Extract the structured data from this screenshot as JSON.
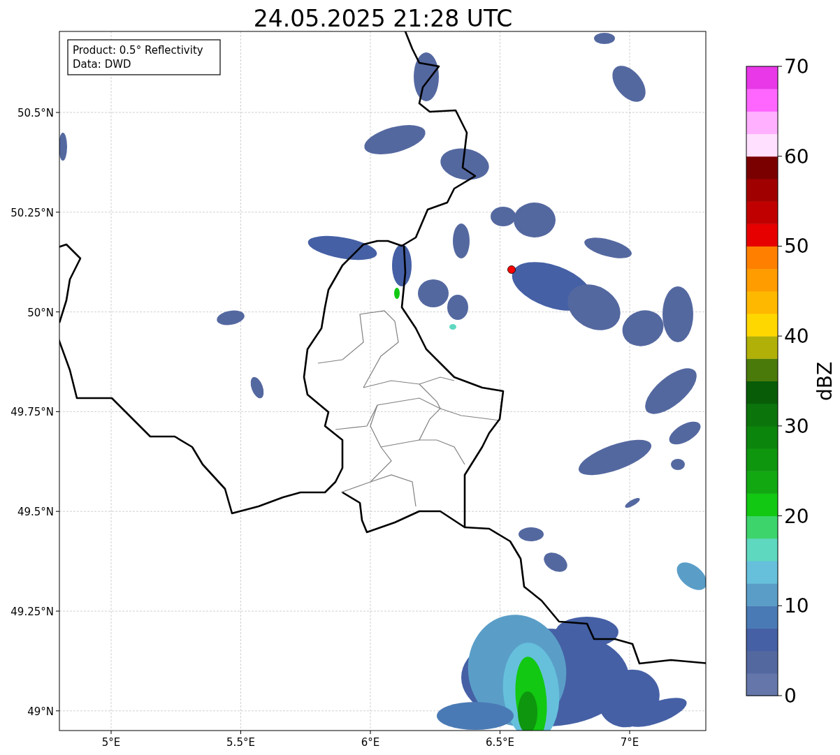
{
  "title": "24.05.2025 21:28 UTC",
  "info_box": [
    "Product: 0.5° Reflectivity",
    "Data: DWD"
  ],
  "map": {
    "lat_ticks": [
      "50.5°N",
      "50.25°N",
      "50°N",
      "49.75°N",
      "49.5°N",
      "49.25°N",
      "49°N"
    ],
    "lon_ticks": [
      "5°E",
      "5.5°E",
      "6°E",
      "6.5°E",
      "7°E"
    ]
  },
  "colorbar": {
    "label": "dBZ",
    "ticks": [
      "70",
      "60",
      "50",
      "40",
      "30",
      "20",
      "10",
      "0"
    ],
    "bins": [
      {
        "color": "#6577aa"
      },
      {
        "color": "#5468a0"
      },
      {
        "color": "#4560a5"
      },
      {
        "color": "#4a7ab5"
      },
      {
        "color": "#5a9ec8"
      },
      {
        "color": "#66c0dc"
      },
      {
        "color": "#5fd8c0"
      },
      {
        "color": "#3dd46c"
      },
      {
        "color": "#12c812"
      },
      {
        "color": "#12a812"
      },
      {
        "color": "#0e960e"
      },
      {
        "color": "#0c850c"
      },
      {
        "color": "#0b740b"
      },
      {
        "color": "#085c08"
      },
      {
        "color": "#4a7a0a"
      },
      {
        "color": "#b0b008"
      },
      {
        "color": "#ffd700"
      },
      {
        "color": "#ffb800"
      },
      {
        "color": "#ff9c00"
      },
      {
        "color": "#ff8000"
      },
      {
        "color": "#e60000"
      },
      {
        "color": "#c00000"
      },
      {
        "color": "#a00000"
      },
      {
        "color": "#7a0000"
      },
      {
        "color": "#ffe0ff"
      },
      {
        "color": "#ffb0ff"
      },
      {
        "color": "#ff66ff"
      },
      {
        "color": "#e838e8"
      }
    ]
  }
}
